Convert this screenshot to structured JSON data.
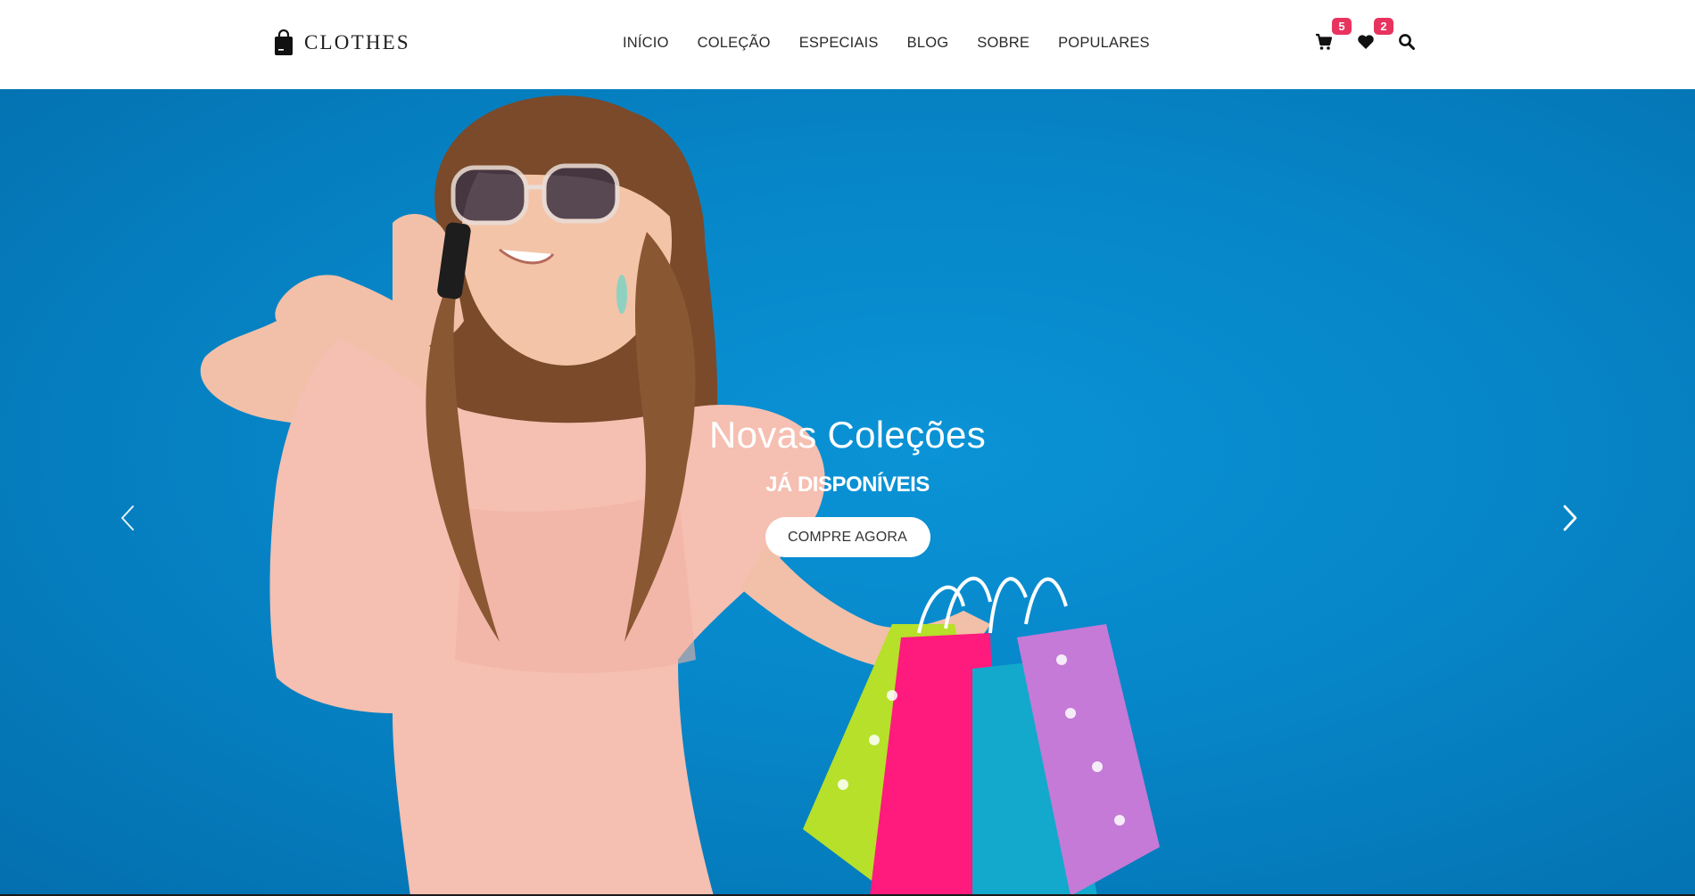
{
  "brand": {
    "name": "CLOTHES"
  },
  "nav": {
    "items": [
      {
        "label": "INÍCIO"
      },
      {
        "label": "COLEÇÃO"
      },
      {
        "label": "ESPECIAIS"
      },
      {
        "label": "BLOG"
      },
      {
        "label": "SOBRE"
      },
      {
        "label": "POPULARES"
      }
    ]
  },
  "header_icons": {
    "cart": {
      "icon": "cart-icon",
      "count": "5"
    },
    "wishlist": {
      "icon": "heart-icon",
      "count": "2"
    },
    "search": {
      "icon": "search-icon"
    }
  },
  "hero": {
    "title": "Novas Coleções",
    "subtitle": "JÁ DISPONÍVEIS",
    "cta_label": "COMPRE AGORA",
    "prev_icon": "chevron-left-icon",
    "next_icon": "chevron-right-icon"
  },
  "colors": {
    "accent_badge": "#e8335e",
    "hero_background": "#0a8fd2",
    "text_dark": "#2a2a2a"
  }
}
